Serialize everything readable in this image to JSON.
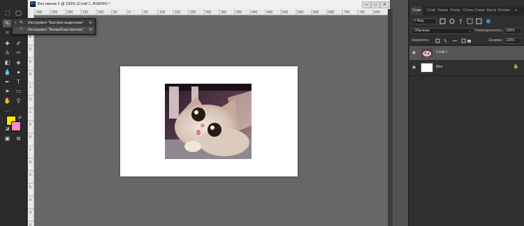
{
  "document": {
    "title": "Без имени-1 @ 100% (Слой 1, RGB/8#) *",
    "logo": "Ps",
    "window_buttons": [
      "—",
      "▭",
      "✕"
    ]
  },
  "ruler": {
    "top_ticks": [
      "300",
      "250",
      "200",
      "150",
      "100",
      "50",
      "0",
      "50",
      "100",
      "150",
      "200",
      "250",
      "300",
      "350",
      "400",
      "450",
      "500",
      "550",
      "600",
      "650",
      "700",
      "750",
      "800",
      "850"
    ],
    "left_ticks": [
      "1",
      "5",
      "0",
      "5",
      "0",
      "1",
      "0",
      "1",
      "5",
      "0",
      "1",
      "0",
      "2",
      "5",
      "0",
      "3",
      "0"
    ]
  },
  "flyout": {
    "items": [
      {
        "label": "Инструмент \"Быстрое выделение\"",
        "key": "W",
        "icon": "quick-selection-icon"
      },
      {
        "label": "Инструмент \"Волшебная палочка\"",
        "key": "W",
        "icon": "magic-wand-icon"
      }
    ]
  },
  "colors": {
    "foreground": "#ffe800",
    "background": "#ff88cc",
    "canvas": "#ffffff"
  },
  "panel": {
    "tabs": [
      "Слои",
      "Слой",
      "Канал",
      "Контр",
      "Стиль",
      "Слоев",
      "Кисти",
      "Истори"
    ],
    "filter_label": "Вид",
    "blend_mode": "Обычные",
    "opacity_label": "Непрозрачность:",
    "opacity_value": "100%",
    "lock_label": "Закрепить:",
    "fill_label": "Заливка:",
    "fill_value": "100%",
    "layers": [
      {
        "name": "Слой 1",
        "selected": true
      },
      {
        "name": "Фон",
        "selected": false,
        "locked": true
      }
    ]
  }
}
